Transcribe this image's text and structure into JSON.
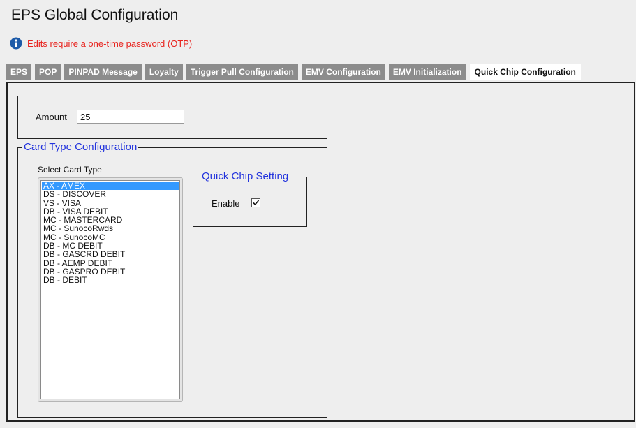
{
  "page": {
    "title": "EPS Global Configuration",
    "otp_notice": "Edits require a one-time password (OTP)",
    "otp_icon": "info-icon"
  },
  "tabs": [
    {
      "label": "EPS",
      "active": false
    },
    {
      "label": "POP",
      "active": false
    },
    {
      "label": "PINPAD Message",
      "active": false
    },
    {
      "label": "Loyalty",
      "active": false
    },
    {
      "label": "Trigger Pull Configuration",
      "active": false
    },
    {
      "label": "EMV Configuration",
      "active": false
    },
    {
      "label": "EMV Initialization",
      "active": false
    },
    {
      "label": "Quick Chip Configuration",
      "active": true
    }
  ],
  "amount": {
    "label": "Amount",
    "value": "25"
  },
  "card_type_config": {
    "legend": "Card Type Configuration",
    "select_label": "Select Card Type",
    "selected_index": 0,
    "cards": [
      "AX - AMEX",
      "DS - DISCOVER",
      "VS - VISA",
      "DB - VISA DEBIT",
      "MC - MASTERCARD",
      "MC - SunocoRwds",
      "MC - SunocoMC",
      "DB - MC DEBIT",
      "DB - GASCRD DEBIT",
      "DB - AEMP DEBIT",
      "DB - GASPRO DEBIT",
      "DB - DEBIT"
    ]
  },
  "quick_chip_setting": {
    "legend": "Quick Chip Setting",
    "enable_label": "Enable",
    "enabled": true
  },
  "colors": {
    "notice_red": "#e8231e",
    "legend_blue": "#2233dd",
    "tab_inactive": "#8c8c8c",
    "selection_blue": "#3399ff"
  }
}
